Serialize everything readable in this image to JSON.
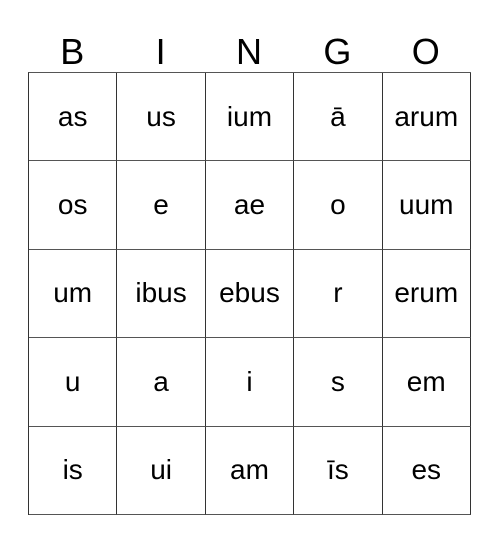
{
  "card": {
    "headers": [
      "B",
      "I",
      "N",
      "G",
      "O"
    ],
    "rows": [
      [
        "as",
        "us",
        "ium",
        "ā",
        "arum"
      ],
      [
        "os",
        "e",
        "ae",
        "o",
        "uum"
      ],
      [
        "um",
        "ibus",
        "ebus",
        "r",
        "erum"
      ],
      [
        "u",
        "a",
        "i",
        "s",
        "em"
      ],
      [
        "is",
        "ui",
        "am",
        "īs",
        "es"
      ]
    ]
  },
  "colors": {
    "background": "#ffffff",
    "text": "#000000",
    "grid_line": "#333333",
    "grid_line_light": "#555555"
  }
}
